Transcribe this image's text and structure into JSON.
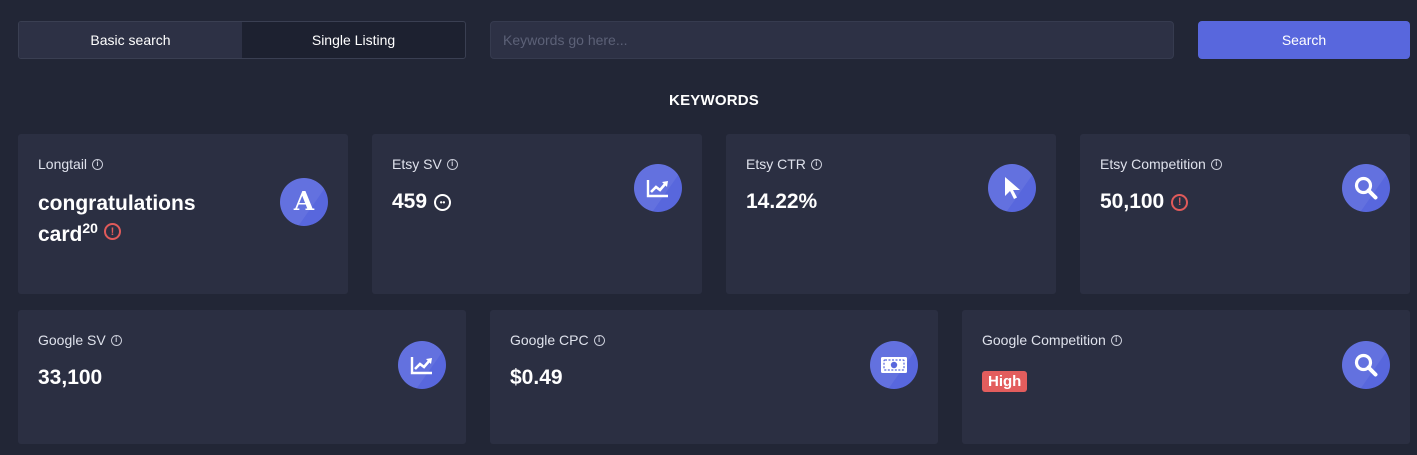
{
  "toggle": {
    "basic_label": "Basic search",
    "single_label": "Single Listing"
  },
  "search": {
    "placeholder": "Keywords go here...",
    "value": "",
    "button_label": "Search"
  },
  "section_title": "KEYWORDS",
  "cards": {
    "longtail": {
      "label": "Longtail",
      "value_line1": "congratulations",
      "value_line2": "card",
      "superscript": "20",
      "icon": "letter-a-icon"
    },
    "etsy_sv": {
      "label": "Etsy SV",
      "value": "459",
      "icon": "trend-chart-icon"
    },
    "etsy_ctr": {
      "label": "Etsy CTR",
      "value": "14.22%",
      "icon": "cursor-icon"
    },
    "etsy_competition": {
      "label": "Etsy Competition",
      "value": "50,100",
      "icon": "magnifier-icon"
    },
    "google_sv": {
      "label": "Google SV",
      "value": "33,100",
      "icon": "trend-chart-icon"
    },
    "google_cpc": {
      "label": "Google CPC",
      "value": "$0.49",
      "icon": "banknote-icon"
    },
    "google_competition": {
      "label": "Google Competition",
      "value": "High",
      "icon": "magnifier-icon"
    }
  },
  "colors": {
    "background": "#222636",
    "card": "#2b2f42",
    "accent": "#5867dd",
    "danger": "#e35d5d"
  }
}
